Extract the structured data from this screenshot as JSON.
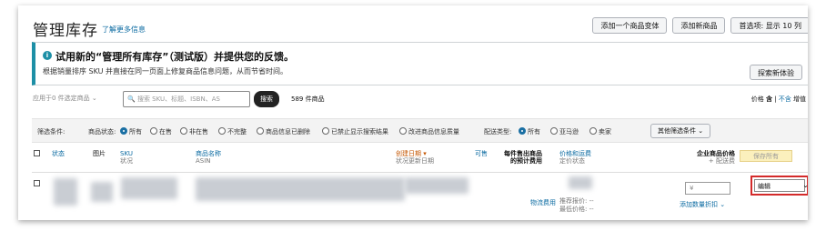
{
  "page": {
    "title": "管理库存",
    "learn_more": "了解更多信息",
    "top_buttons": [
      "添加一个商品变体",
      "添加新商品",
      "首选项: 显示 10 列"
    ]
  },
  "banner": {
    "title": "试用新的“管理所有库存”（测试版）并提供您的反馈。",
    "subtitle": "根据销量排序 SKU 并直接在同一页面上修复商品信息问题，从而节省时间。",
    "button": "探索新体验"
  },
  "toolbar": {
    "apply_label": "应用于0 件选定商品",
    "search_placeholder": "搜索 SKU、标题、ISBN、AS",
    "search_button": "搜索",
    "count": "589 件商品",
    "price_label": "价格",
    "price_incl": "含",
    "price_excl": "不含",
    "price_suffix": "增值"
  },
  "filters": {
    "label": "筛选条件:",
    "status_label": "商品状态:",
    "status_options": [
      "所有",
      "在售",
      "非在售",
      "不完整",
      "商品信息已删除",
      "已禁止显示搜索结果",
      "改进商品信息质量"
    ],
    "fulfillment_label": "配送类型:",
    "fulfillment_options": [
      "所有",
      "亚马逊",
      "卖家"
    ],
    "more_button": "其他筛选条件"
  },
  "table": {
    "headers": {
      "status": "状态",
      "image": "图片",
      "sku": "SKU",
      "sku_sub": "状况",
      "name": "商品名称",
      "name_sub": "ASIN",
      "created": "创建日期",
      "created_sub": "状况更新日期",
      "available": "可售",
      "fee1": "每件售出商品",
      "fee2": "的预计费用",
      "price_fee": "价格和运费",
      "price_sub": "定价状态",
      "biz1": "企业商品价格",
      "biz2": "+ 配送费",
      "save_all": "保存所有"
    },
    "row": {
      "fee_link": "物流费用",
      "recommended": "推荐报价:",
      "recommended_val": "--",
      "lowest": "最低价格:",
      "lowest_val": "--",
      "price_input": "¥",
      "add_discount": "添加数量折扣",
      "action": "编辑"
    }
  }
}
